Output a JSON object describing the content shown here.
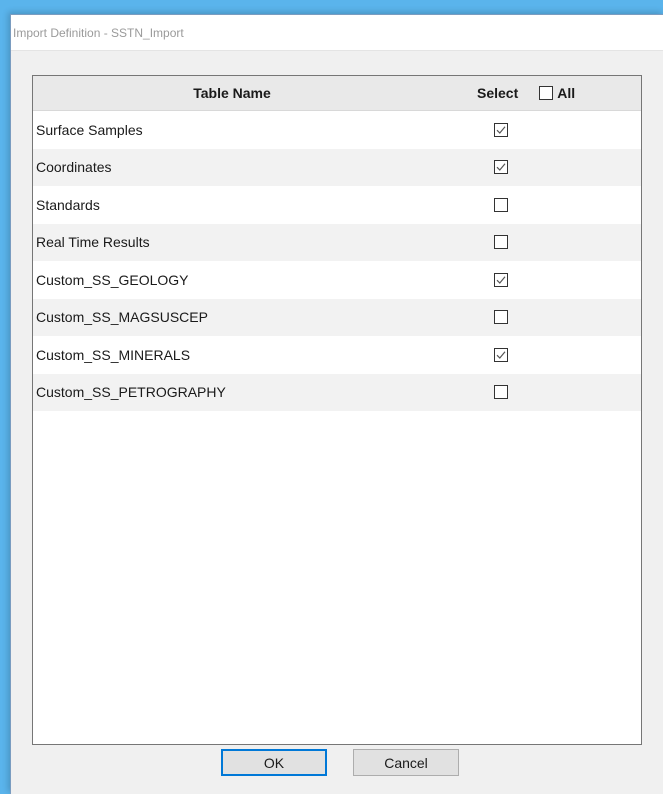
{
  "window": {
    "title": "Import Definition - SSTN_Import"
  },
  "grid": {
    "columns": {
      "table_name": "Table Name",
      "select": "Select",
      "all": "All"
    },
    "select_all_checked": false,
    "rows": [
      {
        "name": "Surface Samples",
        "checked": true
      },
      {
        "name": "Coordinates",
        "checked": true
      },
      {
        "name": "Standards",
        "checked": false
      },
      {
        "name": "Real Time Results",
        "checked": false
      },
      {
        "name": "Custom_SS_GEOLOGY",
        "checked": true
      },
      {
        "name": "Custom_SS_MAGSUSCEP",
        "checked": false
      },
      {
        "name": "Custom_SS_MINERALS",
        "checked": true
      },
      {
        "name": "Custom_SS_PETROGRAPHY",
        "checked": false
      }
    ]
  },
  "buttons": {
    "ok": "OK",
    "cancel": "Cancel"
  },
  "colors": {
    "desktop": "#5ab4ec",
    "dialog_background": "#f0f0f0",
    "default_button_border": "#0078d7",
    "alt_row": "#f2f2f2"
  }
}
